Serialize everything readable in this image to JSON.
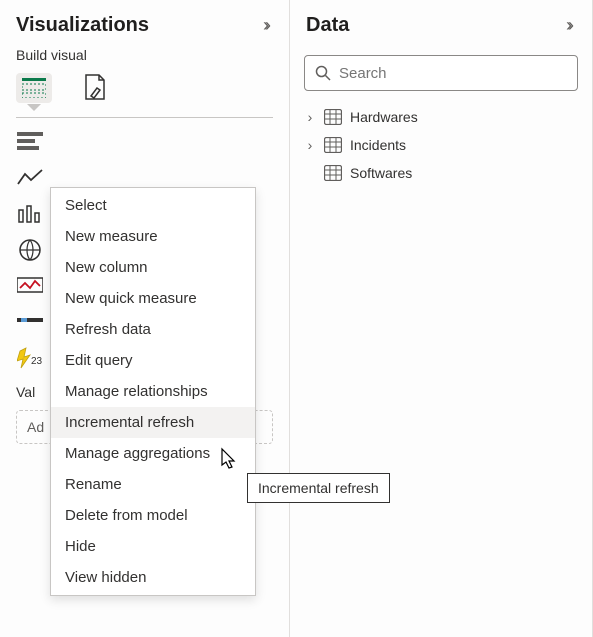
{
  "viz": {
    "title": "Visualizations",
    "subtitle": "Build visual",
    "values_label": "Val",
    "add_placeholder": "Ad"
  },
  "data": {
    "title": "Data",
    "search_placeholder": "Search",
    "tables": [
      {
        "name": "Hardwares"
      },
      {
        "name": "Incidents"
      },
      {
        "name": "Softwares"
      }
    ]
  },
  "context_menu": {
    "items": [
      "Select",
      "New measure",
      "New column",
      "New quick measure",
      "Refresh data",
      "Edit query",
      "Manage relationships",
      "Incremental refresh",
      "Manage aggregations",
      "Rename",
      "Delete from model",
      "Hide",
      "View hidden"
    ],
    "hover_index": 7
  },
  "tooltip": "Incremental refresh"
}
